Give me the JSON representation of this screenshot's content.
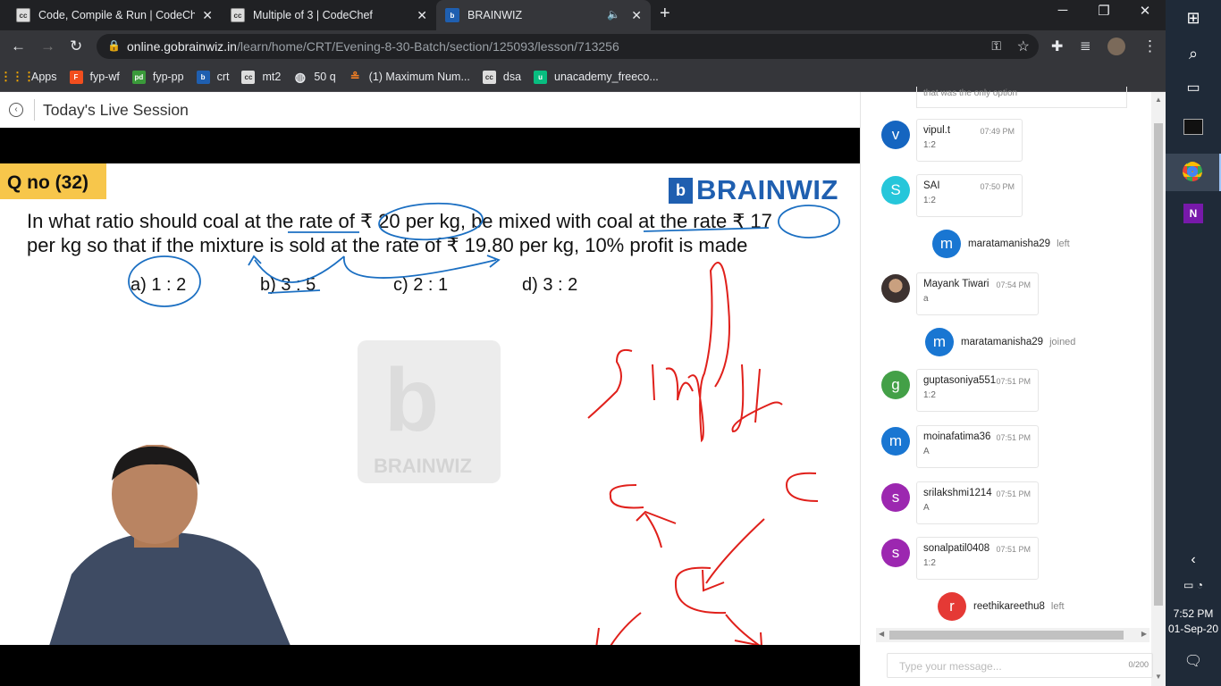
{
  "tabs": [
    {
      "title": "Code, Compile & Run | CodeChef",
      "icon": "codechef-icon"
    },
    {
      "title": "Multiple of 3 | CodeChef",
      "icon": "codechef-icon"
    },
    {
      "title": "BRAINWIZ",
      "icon": "brainwiz-icon",
      "active": true
    }
  ],
  "address": {
    "domain": "online.gobrainwiz.in",
    "path": "/learn/home/CRT/Evening-8-30-Batch/section/125093/lesson/713256"
  },
  "bookmarks": [
    {
      "label": "Apps",
      "icon": "apps-grid-icon"
    },
    {
      "label": "fyp-wf",
      "icon": "figma-icon"
    },
    {
      "label": "fyp-pp",
      "icon": "pdf-icon"
    },
    {
      "label": "crt",
      "icon": "brainwiz-icon"
    },
    {
      "label": "mt2",
      "icon": "codechef-icon"
    },
    {
      "label": "50 q",
      "icon": "globe-icon"
    },
    {
      "label": "(1) Maximum Num...",
      "icon": "stackoverflow-icon"
    },
    {
      "label": "dsa",
      "icon": "codechef-icon"
    },
    {
      "label": "unacademy_freeco...",
      "icon": "unacademy-icon"
    }
  ],
  "session": {
    "title": "Today's Live Session"
  },
  "slide": {
    "qno": "Q no (32)",
    "brand": "BRAINWIZ",
    "watermark": "BRAINWIZ",
    "line1": "In what ratio should coal at the rate of ₹ 20 per kg, be mixed with coal at the rate ₹ 17",
    "line2": "per kg so that if the mixture is sold at the rate of ₹ 19.80 per kg, 10% profit is made",
    "options": [
      "a) 1 : 2",
      "b) 3 : 5",
      "c) 2 : 1",
      "d) 3 : 2"
    ]
  },
  "chat": {
    "top_partial": "that was the only option",
    "messages": [
      {
        "kind": "msg",
        "initial": "v",
        "color": "#1565c0",
        "name": "vipul.t",
        "time": "07:49 PM",
        "text": "1:2"
      },
      {
        "kind": "msg",
        "initial": "S",
        "color": "#26c6da",
        "name": "SAI",
        "time": "07:50 PM",
        "text": "1:2"
      },
      {
        "kind": "sys",
        "initial": "m",
        "color": "#1976d2",
        "name": "maratamanisha29",
        "status": "left"
      },
      {
        "kind": "msg",
        "initial": "",
        "color": "#6d4c41",
        "name": "Mayank Tiwari",
        "time": "07:54 PM",
        "text": "a"
      },
      {
        "kind": "sys",
        "initial": "m",
        "color": "#1976d2",
        "name": "maratamanisha29",
        "status": "joined"
      },
      {
        "kind": "msg",
        "initial": "g",
        "color": "#43a047",
        "name": "guptasoniya551",
        "time": "07:51 PM",
        "text": "1:2"
      },
      {
        "kind": "msg",
        "initial": "m",
        "color": "#1976d2",
        "name": "moinafatima36",
        "time": "07:51 PM",
        "text": "A"
      },
      {
        "kind": "msg",
        "initial": "s",
        "color": "#9c27b0",
        "name": "srilakshmi1214",
        "time": "07:51 PM",
        "text": "A"
      },
      {
        "kind": "msg",
        "initial": "s",
        "color": "#9c27b0",
        "name": "sonalpatil0408",
        "time": "07:51 PM",
        "text": "1:2"
      },
      {
        "kind": "sys",
        "initial": "r",
        "color": "#e53935",
        "name": "reethikareethu8",
        "status": "left"
      }
    ],
    "input_placeholder": "Type your message...",
    "counter": "0/200"
  },
  "taskbar": {
    "time": "7:52 PM",
    "date": "01-Sep-20"
  },
  "colors": {
    "ink_red": "#e0201b",
    "ink_blue": "#1b6fc2",
    "brand_blue": "#1f5fb0",
    "qno_bg": "#f7c64b"
  }
}
